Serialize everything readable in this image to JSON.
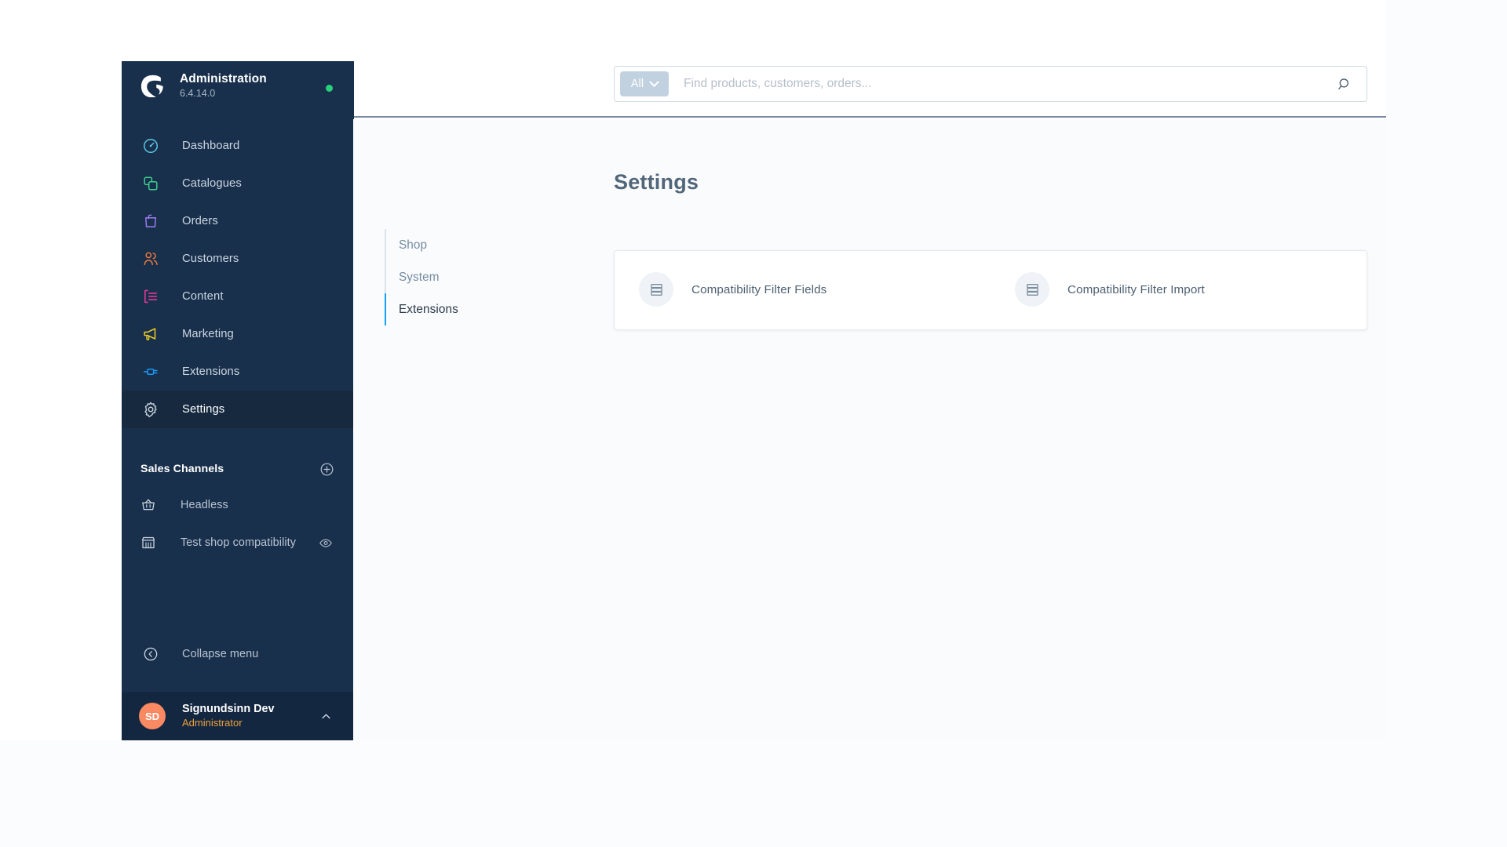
{
  "sidebar": {
    "brand": {
      "title": "Administration",
      "version": "6.4.14.0",
      "logo_icon": "shopware-logo-icon",
      "status_dot_color": "#26d07c"
    },
    "nav_items": [
      {
        "label": "Dashboard",
        "icon": "dashboard-gauge-icon",
        "color": "#5ac8e6",
        "active": false
      },
      {
        "label": "Catalogues",
        "icon": "catalogues-layers-icon",
        "color": "#3ecf8e",
        "active": false
      },
      {
        "label": "Orders",
        "icon": "orders-bag-icon",
        "color": "#9d7cf0",
        "active": false
      },
      {
        "label": "Customers",
        "icon": "customers-people-icon",
        "color": "#f07a3c",
        "active": false
      },
      {
        "label": "Content",
        "icon": "content-document-icon",
        "color": "#f0399b",
        "active": false
      },
      {
        "label": "Marketing",
        "icon": "marketing-megaphone-icon",
        "color": "#f2d024",
        "active": false
      },
      {
        "label": "Extensions",
        "icon": "extensions-plug-icon",
        "color": "#189eff",
        "active": false
      },
      {
        "label": "Settings",
        "icon": "settings-gear-icon",
        "color": "#c9d3de",
        "active": true
      }
    ],
    "sales_channels": {
      "title": "Sales Channels",
      "add_icon": "plus-circle-icon",
      "items": [
        {
          "label": "Headless",
          "icon": "basket-icon",
          "has_eye": false
        },
        {
          "label": "Test shop compatibility",
          "icon": "storefront-icon",
          "has_eye": true,
          "eye_icon": "eye-icon"
        }
      ]
    },
    "collapse": {
      "label": "Collapse menu",
      "icon": "chevron-left-circle-icon"
    },
    "user": {
      "initials": "SD",
      "name": "Signundsinn Dev",
      "role": "Administrator",
      "chevron_icon": "chevron-up-icon",
      "avatar_color": "#f88962"
    }
  },
  "topbar": {
    "search": {
      "scope_label": "All",
      "scope_chevron_icon": "chevron-down-icon",
      "placeholder": "Find products, customers, orders...",
      "value": "",
      "submit_icon": "search-icon"
    }
  },
  "main": {
    "page_title": "Settings",
    "tabs": [
      {
        "label": "Shop",
        "active": false
      },
      {
        "label": "System",
        "active": false
      },
      {
        "label": "Extensions",
        "active": true
      }
    ],
    "extension_cards": [
      {
        "label": "Compatibility Filter Fields",
        "icon": "database-stack-icon"
      },
      {
        "label": "Compatibility Filter Import",
        "icon": "database-stack-icon"
      }
    ]
  }
}
